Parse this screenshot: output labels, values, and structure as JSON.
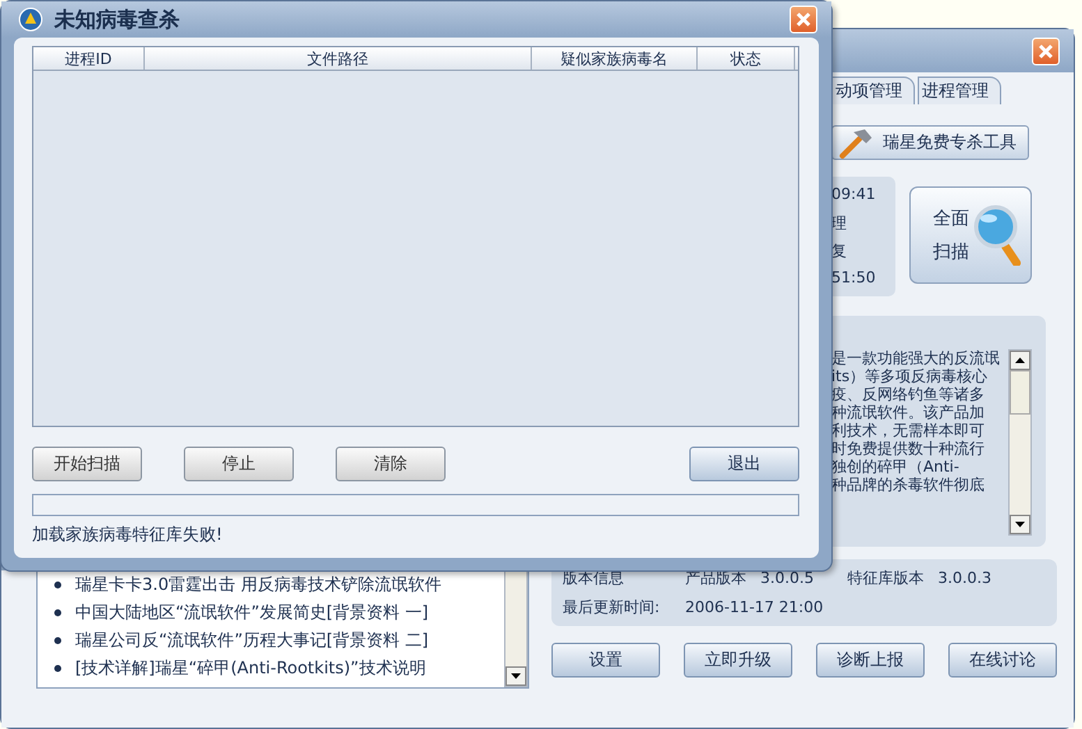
{
  "unknown_virus_window": {
    "title": "未知病毒查杀",
    "table": {
      "columns": [
        "进程ID",
        "文件路径",
        "疑似家族病毒名",
        "状态"
      ]
    },
    "buttons": [
      {
        "label": "开始扫描",
        "kind": "left"
      },
      {
        "label": "停止",
        "kind": "left"
      },
      {
        "label": "清除",
        "kind": "left"
      },
      {
        "label": "退出",
        "kind": "right"
      }
    ],
    "progress": {
      "level": 0
    },
    "status_text": "加载家族病毒特征库失败!"
  },
  "main_window": {
    "tabs": [
      {
        "label": "动项管理",
        "selected": false
      },
      {
        "label": "进程管理",
        "selected": false
      }
    ],
    "tool_button": "瑞星免费专杀工具",
    "scan_info": [
      "09:41",
      "理",
      "复",
      "51:50"
    ],
    "scan_button": [
      "全面",
      "扫描"
    ],
    "description": [
      "是一款功能强大的反流氓",
      "its）等多项反病毒核心",
      "疫、反网络钓鱼等诸多",
      "种流氓软件。该产品加",
      "利技术，无需样本即可",
      "时免费提供数十种流行",
      "独创的碎甲（Anti-",
      "种品牌的杀毒软件彻底"
    ],
    "news": [
      "瑞星卡卡3.0雷霆出击  用反病毒技术铲除流氓软件",
      "中国大陆地区“流氓软件”发展简史[背景资料 一]",
      "瑞星公司反“流氓软件”历程大事记[背景资料 二]",
      "[技术详解]瑞星“碎甲(Anti-Rootkits)”技术说明"
    ],
    "version_info": {
      "label": "版本信息",
      "product_version_label": "产品版本",
      "product_version": "3.0.0.5",
      "signature_version_label": "特征库版本",
      "signature_version": "3.0.0.3",
      "update_label": "最后更新时间:",
      "update_time": "2006-11-17 21:00"
    },
    "buttons": [
      "设置",
      "立即升级",
      "诊断上报",
      "在线讨论"
    ]
  }
}
